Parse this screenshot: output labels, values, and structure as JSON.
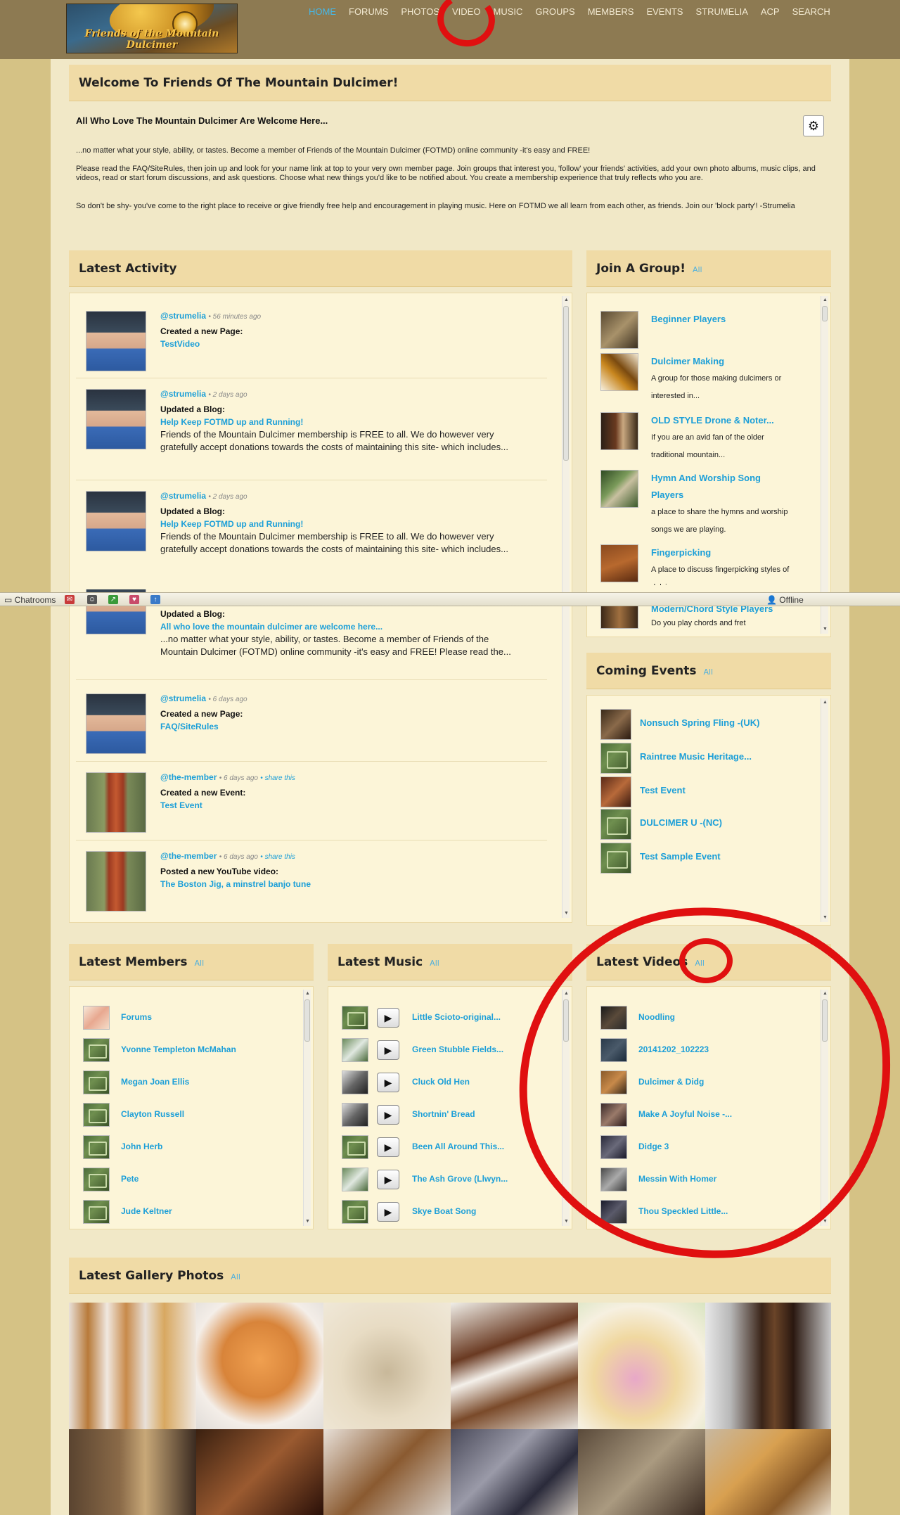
{
  "site": {
    "logo_text": "Friends of the Mountain Dulcimer"
  },
  "nav": {
    "items": [
      "HOME",
      "FORUMS",
      "PHOTOS",
      "VIDEO",
      "MUSIC",
      "GROUPS",
      "MEMBERS",
      "EVENTS",
      "STRUMELIA",
      "ACP",
      "SEARCH"
    ],
    "active": "HOME"
  },
  "welcome": {
    "title": "Welcome To Friends Of The Mountain Dulcimer!",
    "subtitle": "All Who Love The Mountain Dulcimer Are Welcome Here...",
    "p1": "...no matter what your style, ability, or tastes. Become a member of Friends of the Mountain Dulcimer (FOTMD) online community -it's easy and FREE!",
    "p2": "Please read the FAQ/SiteRules, then join up and look for your name link at top to your very own member page. Join groups that interest you, 'follow' your friends' activities, add your own photo albums, music clips, and videos, read or start forum discussions, and ask questions. Choose what new things you'd like to be notified about. You create a membership experience that truly reflects who you are.",
    "p3": "So don't be shy- you've come to the right place to receive or give friendly free help and encouragement in playing music. Here on FOTMD we all learn from each other, as friends.  Join our 'block party'!  -Strumelia"
  },
  "activity": {
    "title": "Latest Activity",
    "items": [
      {
        "user": "@strumelia",
        "time": "• 56 minutes ago",
        "share": "",
        "action": "Created a new Page:",
        "title": "TestVideo",
        "body": "",
        "avatar": "person"
      },
      {
        "user": "@strumelia",
        "time": "• 2 days ago",
        "share": "",
        "action": "Updated a Blog:",
        "title": "Help Keep FOTMD up and Running!",
        "body": "Friends of the Mountain Dulcimer membership is FREE to all. We do however very gratefully accept donations towards the costs of maintaining this site- which includes...",
        "avatar": "person"
      },
      {
        "user": "@strumelia",
        "time": "• 2 days ago",
        "share": "",
        "action": "Updated a Blog:",
        "title": "Help Keep FOTMD up and Running!",
        "body": "Friends of the Mountain Dulcimer membership is FREE to all. We do however very gratefully accept donations towards the costs of maintaining this site- which includes...",
        "avatar": "person"
      },
      {
        "user": "",
        "time": "",
        "share": "",
        "action": "Updated a Blog:",
        "title": "All who love the mountain dulcimer are welcome here...",
        "body": "...no matter what your style, ability, or tastes. Become a member of Friends of the Mountain Dulcimer (FOTMD) online community -it's easy and FREE! Please read the...",
        "avatar": "person"
      },
      {
        "user": "@strumelia",
        "time": "• 6 days ago",
        "share": "",
        "action": "Created a new Page:",
        "title": "FAQ/SiteRules",
        "body": "",
        "avatar": "person"
      },
      {
        "user": "@the-member",
        "time": "• 6 days ago",
        "share": "• share this",
        "action": "Created a new Event:",
        "title": "Test Event",
        "body": "",
        "avatar": "dulcimer"
      },
      {
        "user": "@the-member",
        "time": "• 6 days ago",
        "share": "• share this",
        "action": "Posted a new YouTube video:",
        "title": "The Boston Jig, a minstrel banjo tune",
        "body": "",
        "avatar": "dulcimer"
      }
    ]
  },
  "groups": {
    "title": "Join A Group!",
    "all": "All",
    "items": [
      {
        "title": "Beginner Players",
        "desc": ""
      },
      {
        "title": "Dulcimer Making",
        "desc": "A group for those making dulcimers or interested in..."
      },
      {
        "title": "OLD STYLE Drone & Noter...",
        "desc": "If you are an avid fan of the older traditional mountain..."
      },
      {
        "title": "Hymn And Worship Song Players",
        "desc": "a place to share the hymns and worship songs we are playing."
      },
      {
        "title": "Fingerpicking",
        "desc": "A place to discuss fingerpicking styles of dulcimer..."
      },
      {
        "title": "Modern/Chord Style Players",
        "desc": "Do you play chords and fret"
      }
    ]
  },
  "events": {
    "title": "Coming Events",
    "all": "All",
    "items": [
      "Nonsuch Spring Fling -(UK)",
      "Raintree Music Heritage...",
      "Test Event",
      "DULCIMER U -(NC)",
      "Test Sample Event"
    ]
  },
  "members": {
    "title": "Latest Members",
    "all": "All",
    "items": [
      "Forums",
      "Yvonne Templeton McMahan",
      "Megan Joan Ellis",
      "Clayton Russell",
      "John Herb",
      "Pete",
      "Jude Keltner"
    ]
  },
  "music": {
    "title": "Latest Music",
    "all": "All",
    "items": [
      "Little Scioto-original...",
      "Green Stubble Fields...",
      "Cluck Old Hen",
      "Shortnin' Bread",
      "Been All Around This...",
      "The Ash Grove (Llwyn...",
      "Skye Boat Song"
    ],
    "play_icon": "▶"
  },
  "videos": {
    "title": "Latest Videos",
    "all": "All",
    "items": [
      "Noodling",
      "20141202_102223",
      "Dulcimer & Didg",
      "Make A Joyful Noise -...",
      "Didge 3",
      "Messin With Homer",
      "Thou Speckled Little..."
    ]
  },
  "gallery": {
    "title": "Latest Gallery Photos",
    "all": "All"
  },
  "chatbar": {
    "label": "Chatrooms",
    "status": "Offline"
  },
  "colors": {
    "link": "#1c9fd8",
    "header_bg": "#f0dba6",
    "panel_bg": "#fcf5d8",
    "annotation": "#e01010"
  }
}
